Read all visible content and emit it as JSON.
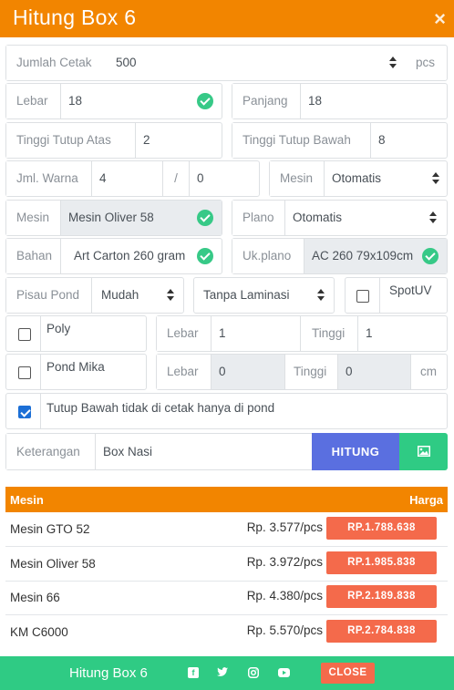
{
  "header": {
    "title": "Hitung Box 6",
    "close_symbol": "×"
  },
  "form": {
    "jumlah_cetak": {
      "label": "Jumlah Cetak",
      "value": "500",
      "unit": "pcs"
    },
    "lebar": {
      "label": "Lebar",
      "value": "18"
    },
    "panjang": {
      "label": "Panjang",
      "value": "18"
    },
    "tinggi_tutup_atas": {
      "label": "Tinggi Tutup Atas",
      "value": "2"
    },
    "tinggi_tutup_bawah": {
      "label": "Tinggi Tutup Bawah",
      "value": "8"
    },
    "jml_warna": {
      "label": "Jml. Warna",
      "value": "4",
      "separator": "/",
      "value2": "0"
    },
    "mesin_select": {
      "label": "Mesin",
      "value": "Otomatis"
    },
    "mesin": {
      "label": "Mesin",
      "value": "Mesin Oliver 58"
    },
    "plano": {
      "label": "Plano",
      "value": "Otomatis"
    },
    "bahan": {
      "label": "Bahan",
      "value": "Art Carton 260 gram"
    },
    "uk_plano": {
      "label": "Uk.plano",
      "value": "AC 260 79x109cm"
    },
    "pisau_pond": {
      "label": "Pisau Pond",
      "value": "Mudah"
    },
    "laminasi": {
      "value": "Tanpa Laminasi"
    },
    "spotuv": {
      "label": "SpotUV",
      "checked": false
    },
    "poly": {
      "label": "Poly",
      "checked": false,
      "lebar_label": "Lebar",
      "lebar": "1",
      "tinggi_label": "Tinggi",
      "tinggi": "1"
    },
    "pond_mika": {
      "label": "Pond Mika",
      "checked": false,
      "lebar_label": "Lebar",
      "lebar": "0",
      "tinggi_label": "Tinggi",
      "tinggi": "0",
      "unit": "cm"
    },
    "tutup_bawah": {
      "label": "Tutup Bawah tidak di cetak hanya di pond",
      "checked": true
    },
    "keterangan": {
      "label": "Keterangan",
      "value": "Box Nasi"
    },
    "hitung_label": "HITUNG"
  },
  "table": {
    "headers": [
      "Mesin",
      "Harga"
    ],
    "rows": [
      {
        "mesin": "Mesin GTO 52",
        "per_pcs": "Rp. 3.577/pcs",
        "total": "RP.1.788.638"
      },
      {
        "mesin": "Mesin Oliver 58",
        "per_pcs": "Rp. 3.972/pcs",
        "total": "RP.1.985.838"
      },
      {
        "mesin": "Mesin 66",
        "per_pcs": "Rp. 4.380/pcs",
        "total": "RP.2.189.838"
      },
      {
        "mesin": "KM C6000",
        "per_pcs": "Rp. 5.570/pcs",
        "total": "RP.2.784.838"
      }
    ]
  },
  "footer": {
    "title": "Hitung Box 6",
    "close_label": "CLOSE",
    "social_icons": [
      "facebook-icon",
      "twitter-icon",
      "instagram-icon",
      "youtube-icon"
    ]
  },
  "colors": {
    "orange": "#f28500",
    "green": "#2fcb84",
    "blue": "#5a6fe0",
    "red": "#f46a4b"
  }
}
